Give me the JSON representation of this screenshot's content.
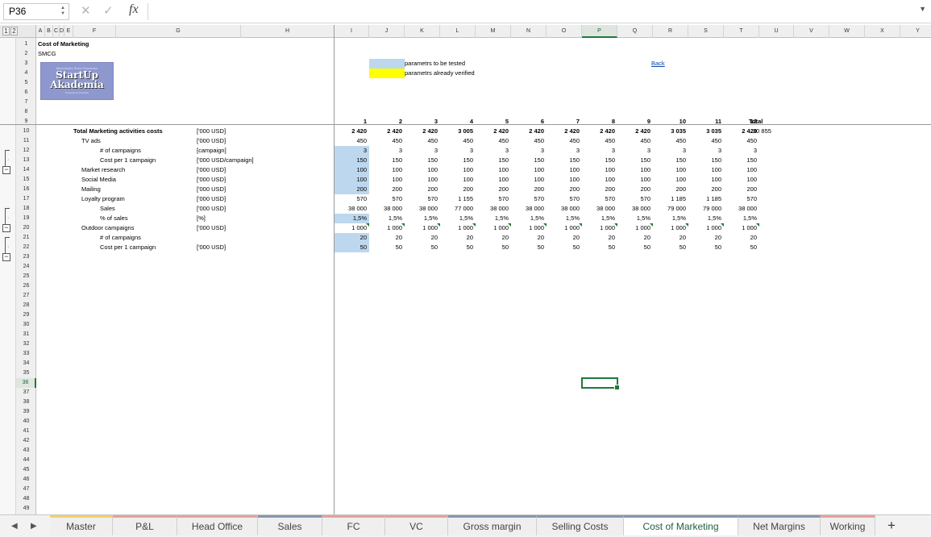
{
  "formula_bar": {
    "cell_ref": "P36",
    "cancel_glyph": "✕",
    "confirm_glyph": "✓",
    "fx_label": "fx",
    "formula": "",
    "expand_glyph": "▼"
  },
  "outline_levels": [
    "1",
    "2"
  ],
  "columns": [
    "A",
    "B",
    "C",
    "D",
    "E",
    "F",
    "G",
    "H",
    "I",
    "J",
    "K",
    "L",
    "M",
    "N",
    "O",
    "P",
    "Q",
    "R",
    "S",
    "T",
    "U",
    "V",
    "W",
    "X",
    "Y"
  ],
  "selected_column": "P",
  "selected_row": 36,
  "row_count": 49,
  "header": {
    "title": "Cost of Marketing",
    "subtitle": "SMCG"
  },
  "logo": {
    "small_text": "Wealsbeale Breet Eeuaenes",
    "brand_line1": "StartUp",
    "brand_line2": "Akademia",
    "tagline": "Powered by Investors"
  },
  "legend": {
    "to_be_tested": "parametrs to be tested",
    "already_verified": "parametrs already verified",
    "to_be_tested_color": "#bdd7ee",
    "verified_color": "#ffff00"
  },
  "back_link": "Back",
  "period_headers": [
    "1",
    "2",
    "3",
    "4",
    "5",
    "6",
    "7",
    "8",
    "9",
    "10",
    "11",
    "12"
  ],
  "total_header": "Total",
  "rows": [
    {
      "label": "Total Marketing activities costs",
      "indent": 0,
      "bold": true,
      "unit": "['000 USD]",
      "values": [
        "2 420",
        "2 420",
        "2 420",
        "3 005",
        "2 420",
        "2 420",
        "2 420",
        "2 420",
        "2 420",
        "3 035",
        "3 035",
        "2 420"
      ],
      "total": "30 855",
      "input": false
    },
    {
      "label": "TV ads",
      "indent": 1,
      "bold": false,
      "unit": "['000 USD]",
      "values": [
        "450",
        "450",
        "450",
        "450",
        "450",
        "450",
        "450",
        "450",
        "450",
        "450",
        "450",
        "450"
      ],
      "total": "",
      "input": false
    },
    {
      "label": "# of campaigns",
      "indent": 2,
      "bold": false,
      "unit": "[campaign]",
      "values": [
        "3",
        "3",
        "3",
        "3",
        "3",
        "3",
        "3",
        "3",
        "3",
        "3",
        "3",
        "3"
      ],
      "total": "",
      "input": true
    },
    {
      "label": "Cost per 1 campaign",
      "indent": 2,
      "bold": false,
      "unit": "['000 USD/campaign]",
      "values": [
        "150",
        "150",
        "150",
        "150",
        "150",
        "150",
        "150",
        "150",
        "150",
        "150",
        "150",
        "150"
      ],
      "total": "",
      "input": true
    },
    {
      "label": "Market research",
      "indent": 1,
      "bold": false,
      "unit": "['000 USD]",
      "values": [
        "100",
        "100",
        "100",
        "100",
        "100",
        "100",
        "100",
        "100",
        "100",
        "100",
        "100",
        "100"
      ],
      "total": "",
      "input": true
    },
    {
      "label": "Social Media",
      "indent": 1,
      "bold": false,
      "unit": "['000 USD]",
      "values": [
        "100",
        "100",
        "100",
        "100",
        "100",
        "100",
        "100",
        "100",
        "100",
        "100",
        "100",
        "100"
      ],
      "total": "",
      "input": true
    },
    {
      "label": "Mailing",
      "indent": 1,
      "bold": false,
      "unit": "['000 USD]",
      "values": [
        "200",
        "200",
        "200",
        "200",
        "200",
        "200",
        "200",
        "200",
        "200",
        "200",
        "200",
        "200"
      ],
      "total": "",
      "input": true
    },
    {
      "label": "Loyalty program",
      "indent": 1,
      "bold": false,
      "unit": "['000 USD]",
      "values": [
        "570",
        "570",
        "570",
        "1 155",
        "570",
        "570",
        "570",
        "570",
        "570",
        "1 185",
        "1 185",
        "570"
      ],
      "total": "",
      "input": false
    },
    {
      "label": "Sales",
      "indent": 2,
      "bold": false,
      "unit": "['000 USD]",
      "values": [
        "38 000",
        "38 000",
        "38 000",
        "77 000",
        "38 000",
        "38 000",
        "38 000",
        "38 000",
        "38 000",
        "79 000",
        "79 000",
        "38 000"
      ],
      "total": "",
      "input": false
    },
    {
      "label": "% of sales",
      "indent": 2,
      "bold": false,
      "unit": "[%]",
      "values": [
        "1,5%",
        "1,5%",
        "1,5%",
        "1,5%",
        "1,5%",
        "1,5%",
        "1,5%",
        "1,5%",
        "1,5%",
        "1,5%",
        "1,5%",
        "1,5%"
      ],
      "total": "",
      "input": true
    },
    {
      "label": "Outdoor campaigns",
      "indent": 1,
      "bold": false,
      "unit": "['000 USD]",
      "values": [
        "1 000",
        "1 000",
        "1 000",
        "1 000",
        "1 000",
        "1 000",
        "1 000",
        "1 000",
        "1 000",
        "1 000",
        "1 000",
        "1 000"
      ],
      "total": "",
      "input": false,
      "flags": true
    },
    {
      "label": "# of campaigns",
      "indent": 2,
      "bold": false,
      "unit": "",
      "values": [
        "20",
        "20",
        "20",
        "20",
        "20",
        "20",
        "20",
        "20",
        "20",
        "20",
        "20",
        "20"
      ],
      "total": "",
      "input": true
    },
    {
      "label": "Cost per 1 campaign",
      "indent": 2,
      "bold": false,
      "unit": "['000 USD]",
      "values": [
        "50",
        "50",
        "50",
        "50",
        "50",
        "50",
        "50",
        "50",
        "50",
        "50",
        "50",
        "50"
      ],
      "total": "",
      "input": true
    }
  ],
  "sheet_tabs": [
    {
      "label": "Master",
      "color": "#f2d16b",
      "active": false
    },
    {
      "label": "P&L",
      "color": "#e8a09a",
      "active": false
    },
    {
      "label": "Head Office",
      "color": "#e8a09a",
      "active": false
    },
    {
      "label": "Sales",
      "color": "#8496b0",
      "active": false
    },
    {
      "label": "FC",
      "color": "#e8a09a",
      "active": false
    },
    {
      "label": "VC",
      "color": "#e8a09a",
      "active": false
    },
    {
      "label": "Gross margin",
      "color": "#8496b0",
      "active": false
    },
    {
      "label": "Selling Costs",
      "color": "#8496b0",
      "active": false
    },
    {
      "label": "Cost of Marketing",
      "color": "#8496b0",
      "active": true
    },
    {
      "label": "Net Margins",
      "color": "#8496b0",
      "active": false
    },
    {
      "label": "Working",
      "color": "#e8a09a",
      "active": false
    }
  ],
  "tab_nav": {
    "prev": "◀",
    "next": "▶",
    "add": "+"
  }
}
